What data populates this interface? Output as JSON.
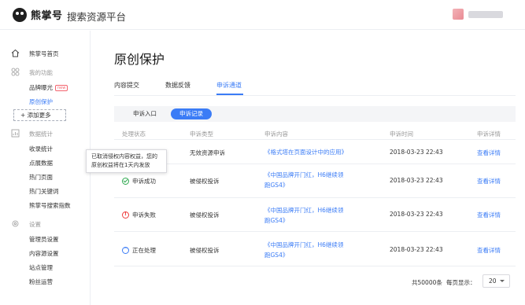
{
  "header": {
    "logo_text": "熊掌号",
    "platform_title": "搜索资源平台"
  },
  "sidebar": {
    "home": "熊掌号首页",
    "section_features": "我的功能",
    "brand_exposure": "品牌曝光",
    "new_badge": "new",
    "original_protection": "原创保护",
    "add_more": "添加更多",
    "section_stats": "数据统计",
    "collection_stats": "收录统计",
    "click_data": "点展数据",
    "hot_pages": "热门页面",
    "hot_keywords": "热门关键词",
    "search_index": "熊掌号搜索指数",
    "section_settings": "设置",
    "admin_settings": "管理员设置",
    "content_source_settings": "内容源设置",
    "site_management": "站点管理",
    "fans_operation": "粉丝运营"
  },
  "main": {
    "title": "原创保护",
    "tabs": [
      "内容提交",
      "数据反馈",
      "申诉通道"
    ],
    "active_tab": "申诉通道",
    "subtabs": [
      "申诉入口",
      "申诉记录"
    ],
    "table": {
      "headers": [
        "处理状态",
        "申诉类型",
        "申诉内容",
        "申诉时间",
        "申诉详情"
      ],
      "rows": [
        {
          "status": "",
          "type": "无效资源申诉",
          "content": "《格式塔在页面设计中的应用》",
          "content2": "",
          "time": "2018-03-23  22:43",
          "detail": "查看详情"
        },
        {
          "status": "申诉成功",
          "type": "被侵权投诉",
          "content": "《中国品牌开门红，H6继续领",
          "content2": "跑GS4》",
          "time": "2018-03-23  22:43",
          "detail": "查看详情"
        },
        {
          "status": "申诉失败",
          "type": "被侵权投诉",
          "content": "《中国品牌开门红，H6继续领",
          "content2": "跑GS4》",
          "time": "2018-03-23  22:43",
          "detail": "查看详情"
        },
        {
          "status": "正在处理",
          "type": "被侵权投诉",
          "content": "《中国品牌开门红，H6继续领",
          "content2": "跑GS4》",
          "time": "2018-03-23  22:43",
          "detail": "查看详情"
        }
      ]
    },
    "tooltip": {
      "line1": "已取消侵权内容权益，您的",
      "line2": "原创权益将在1天内发放"
    },
    "pagination": {
      "total": "共50000条",
      "per_page_label": "每页显示：",
      "per_page_value": "20"
    }
  },
  "colors": {
    "accent": "#3b7cf6",
    "success": "#2ea84f",
    "fail": "#ee3c3c"
  }
}
